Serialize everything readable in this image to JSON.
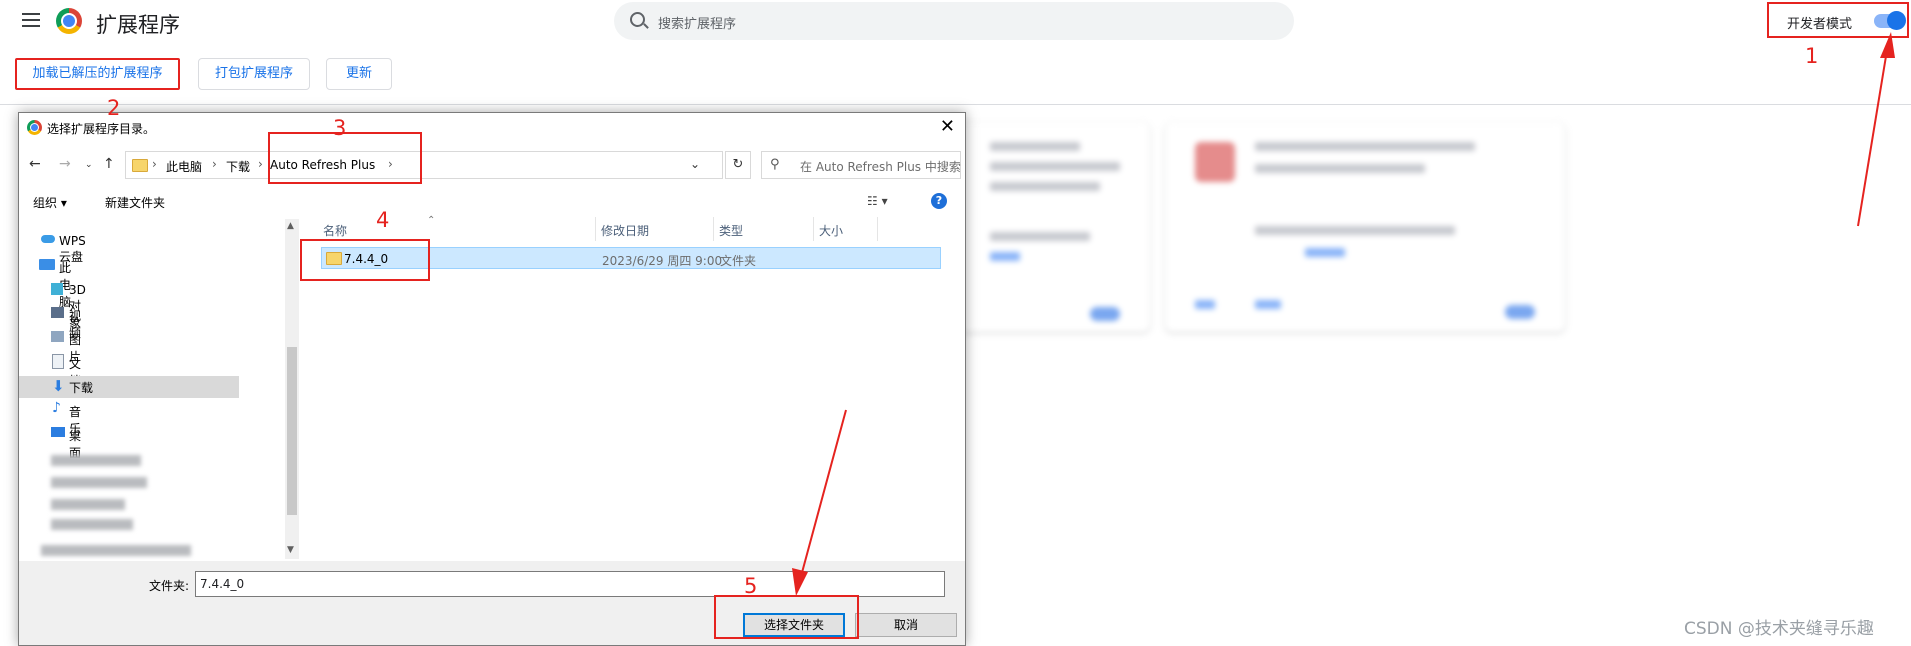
{
  "page": {
    "title": "扩展程序",
    "search_placeholder": "搜索扩展程序",
    "dev_mode_label": "开发者模式",
    "dev_mode_on": true,
    "buttons": {
      "load_unpacked": "加载已解压的扩展程序",
      "pack": "打包扩展程序",
      "update": "更新"
    }
  },
  "dialog": {
    "title": "选择扩展程序目录。",
    "breadcrumb": [
      "此电脑",
      "下载",
      "Auto Refresh Plus"
    ],
    "search_placeholder": "在 Auto Refresh Plus 中搜索",
    "commands": {
      "organize": "组织 ▾",
      "new_folder": "新建文件夹"
    },
    "nav_items": [
      {
        "label": "WPS云盘",
        "icon": "cloud-icon"
      },
      {
        "label": "此电脑",
        "icon": "computer-icon"
      },
      {
        "label": "3D 对象",
        "icon": "cube-icon"
      },
      {
        "label": "视频",
        "icon": "video-icon"
      },
      {
        "label": "图片",
        "icon": "picture-icon"
      },
      {
        "label": "文档",
        "icon": "document-icon"
      },
      {
        "label": "下载",
        "icon": "download-icon",
        "selected": true
      },
      {
        "label": "音乐",
        "icon": "music-icon"
      },
      {
        "label": "桌面",
        "icon": "desktop-icon"
      }
    ],
    "columns": {
      "name": "名称",
      "modified": "修改日期",
      "type": "类型",
      "size": "大小"
    },
    "files": [
      {
        "name": "7.4.4_0",
        "modified": "2023/6/29 周四 9:00",
        "type": "文件夹",
        "size": ""
      }
    ],
    "filename_label": "文件夹:",
    "filename_value": "7.4.4_0",
    "buttons": {
      "select": "选择文件夹",
      "cancel": "取消"
    }
  },
  "annotations": [
    "1",
    "2",
    "3",
    "4",
    "5"
  ],
  "watermark": "CSDN @技术夹缝寻乐趣",
  "colors": {
    "annotation_red": "#e5231f",
    "chrome_blue": "#1a73e8",
    "selection": "#cce8ff"
  }
}
